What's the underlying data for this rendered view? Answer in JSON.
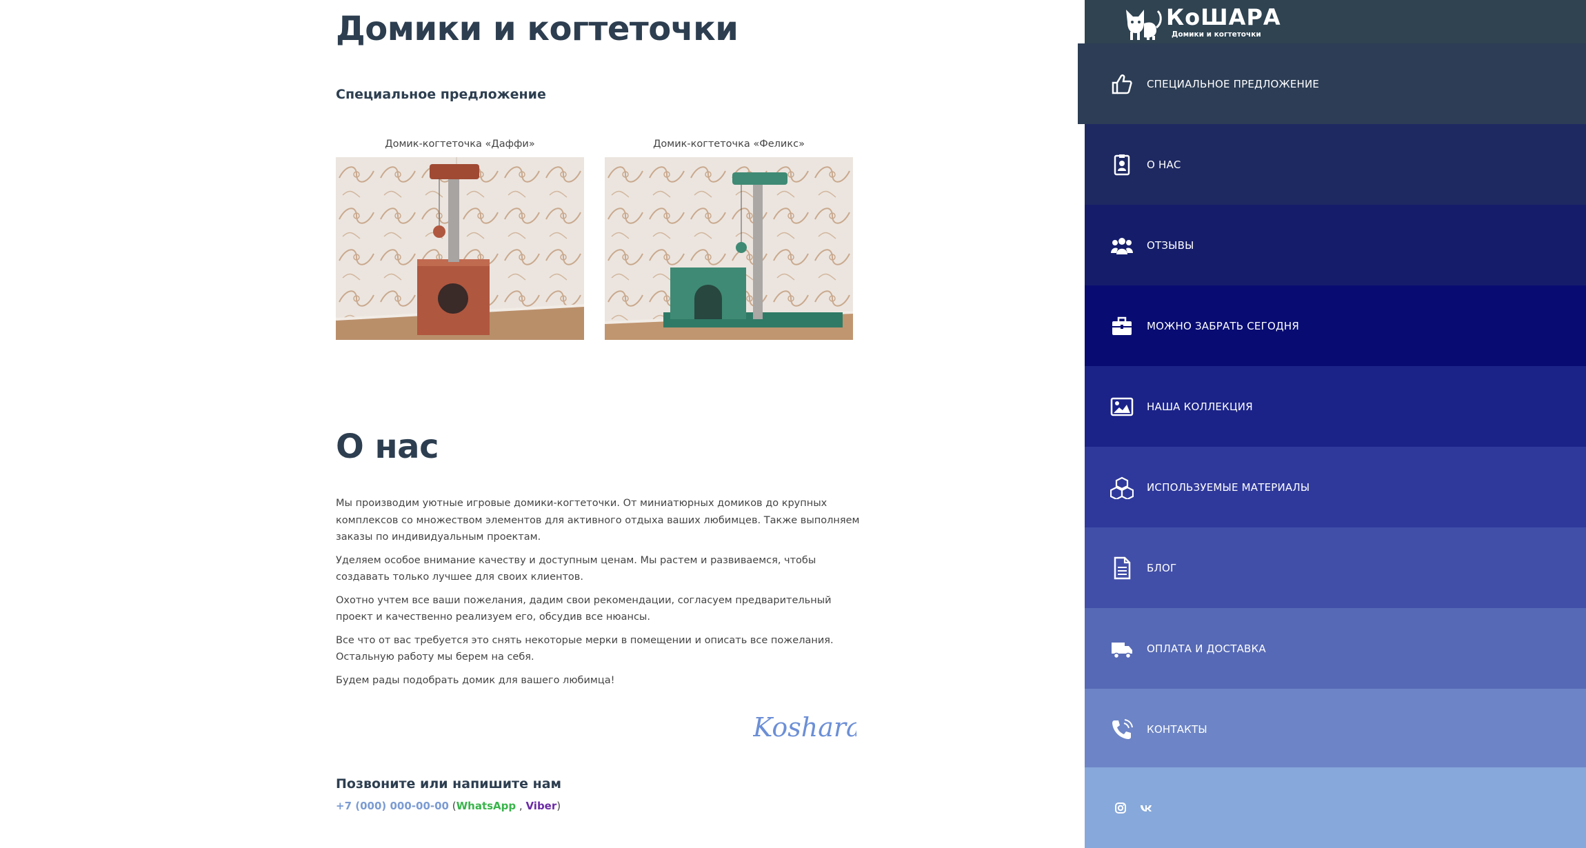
{
  "main": {
    "title": "Домики и когтеточки",
    "special_heading": "Специальное предложение",
    "products": [
      {
        "caption": "Домик-когтеточка «Даффи»",
        "color": "#b0573f"
      },
      {
        "caption": "Домик-когтеточка «Феликс»",
        "color": "#3f8a74"
      }
    ],
    "about_title": "О нас",
    "about_paragraphs": [
      "Мы производим уютные игровые домики-когтеточки. От миниатюрных домиков до крупных комплексов со множеством элементов для активного отдыха ваших любимцев. Также выполняем заказы по индивидуальным проектам.",
      "Уделяем особое внимание качеству и доступным ценам. Мы растем и развиваемся, чтобы создавать только лучшее для своих клиентов.",
      "Охотно учтем все ваши пожелания, дадим свои рекомендации, согласуем предварительный проект и качественно реализуем его, обсудив все нюансы.",
      "Все что от вас требуется это снять некоторые мерки в помещении и описать все пожелания. Остальную работу мы берем на себя.",
      "Будем рады подобрать домик для вашего любимца!"
    ],
    "signature": "Koshara",
    "contact_heading": "Позвоните или напишите нам",
    "contact": {
      "phone": "+7 (000) 000-00-00",
      "open_paren": " (",
      "whatsapp": "WhatsApp",
      "separator": " , ",
      "viber": "Viber",
      "close_paren": ")"
    }
  },
  "sidebar": {
    "logo_text": "КоШАРА",
    "logo_subtitle": "Домики и когтеточки",
    "items": [
      {
        "label": "СПЕЦИАЛЬНОЕ ПРЕДЛОЖЕНИЕ",
        "icon": "thumbs-up-icon",
        "bg": "#2c3d55"
      },
      {
        "label": "О НАС",
        "icon": "id-badge-icon",
        "bg": "#1e2962"
      },
      {
        "label": "ОТЗЫВЫ",
        "icon": "users-icon",
        "bg": "#151d6b"
      },
      {
        "label": "МОЖНО ЗАБРАТЬ СЕГОДНЯ",
        "icon": "briefcase-icon",
        "bg": "#080c72"
      },
      {
        "label": "НАША КОЛЛЕКЦИЯ",
        "icon": "image-icon",
        "bg": "#1b2388"
      },
      {
        "label": "ИСПОЛЬЗУЕМЫЕ МАТЕРИАЛЫ",
        "icon": "cubes-icon",
        "bg": "#2f399b"
      },
      {
        "label": "БЛОГ",
        "icon": "document-icon",
        "bg": "#424fa8"
      },
      {
        "label": "ОПЛАТА И ДОСТАВКА",
        "icon": "truck-icon",
        "bg": "#5669b6"
      },
      {
        "label": "КОНТАКТЫ",
        "icon": "phone-icon",
        "bg": "#6d85c6"
      }
    ],
    "social": [
      {
        "icon": "instagram-icon"
      },
      {
        "icon": "vk-icon"
      }
    ]
  },
  "colors": {
    "heading": "#2d3e50",
    "sidebar_top": "#2f4351",
    "social_bg": "#87a8da",
    "signature": "#6c8fd6"
  }
}
